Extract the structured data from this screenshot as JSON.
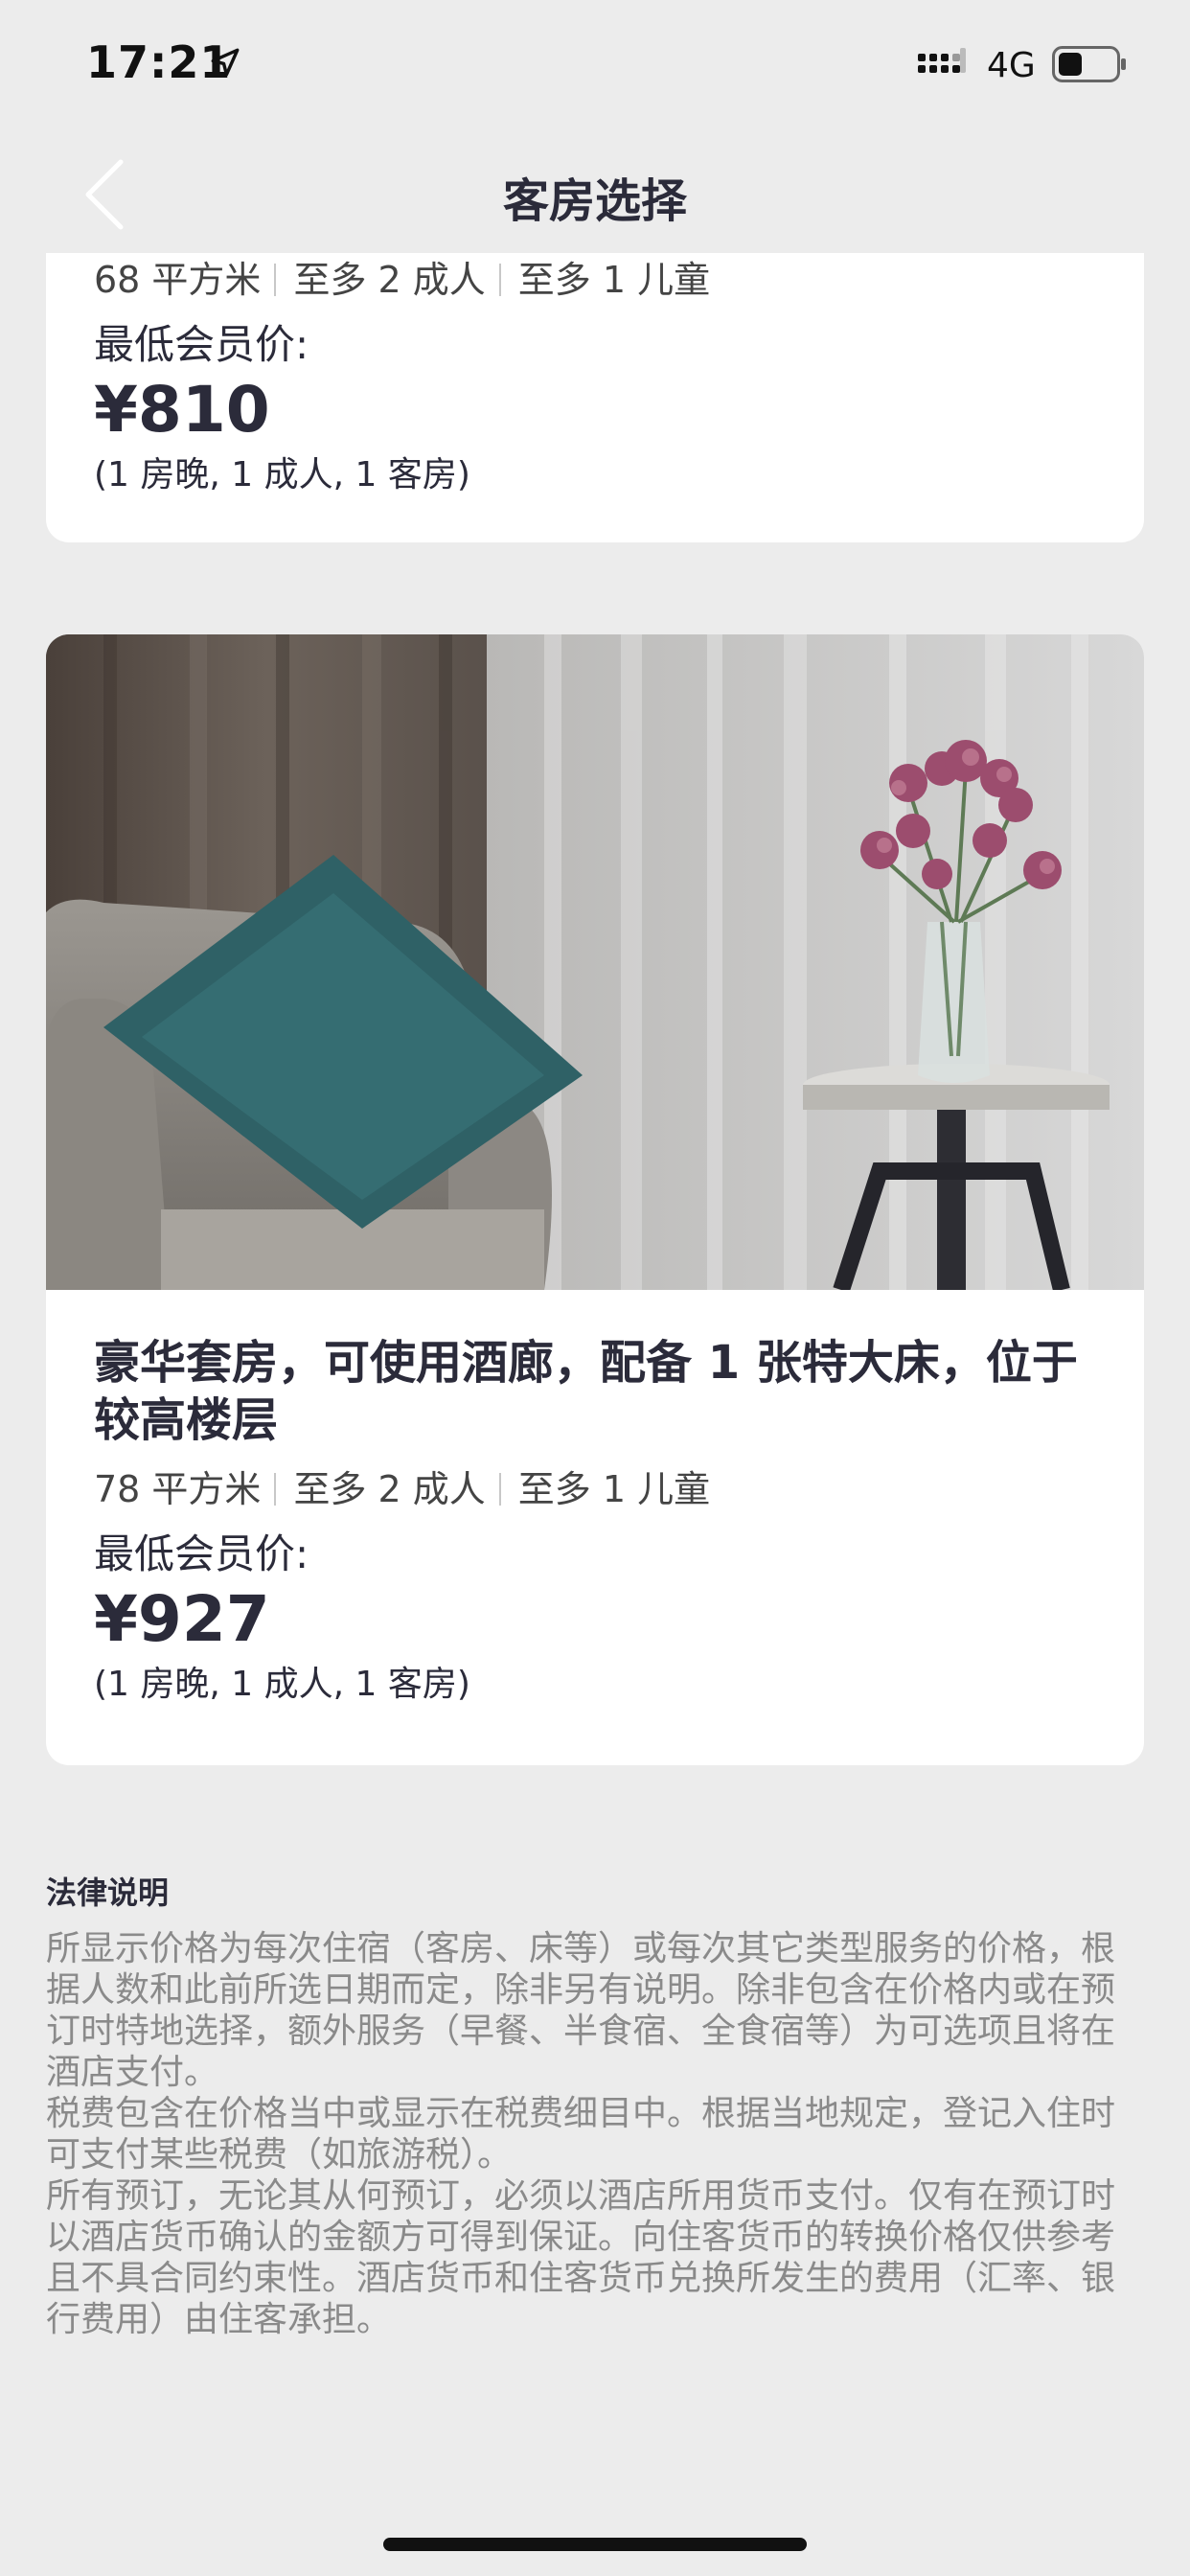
{
  "status_bar": {
    "time": "17:21",
    "network": "4G"
  },
  "nav": {
    "title": "客房选择"
  },
  "rooms": [
    {
      "name": "",
      "area": "68 平方米",
      "adults": "至多 2 成人",
      "children": "至多 1 儿童",
      "price_label": "最低会员价:",
      "price": "¥810",
      "price_note": "(1 房晚, 1 成人, 1 客房)"
    },
    {
      "name": "豪华套房，可使用酒廊，配备 1 张特大床，位于较高楼层",
      "area": "78 平方米",
      "adults": "至多 2 成人",
      "children": "至多 1 儿童",
      "price_label": "最低会员价:",
      "price": "¥927",
      "price_note": "(1 房晚, 1 成人, 1 客房)"
    }
  ],
  "legal": {
    "title": "法律说明",
    "paragraphs": [
      "所显示价格为每次住宿（客房、床等）或每次其它类型服务的价格，根据人数和此前所选日期而定，除非另有说明。除非包含在价格内或在预订时特地选择，额外服务（早餐、半食宿、全食宿等）为可选项且将在酒店支付。",
      "税费包含在价格当中或显示在税费细目中。根据当地规定，登记入住时可支付某些税费（如旅游税）。",
      "所有预订，无论其从何预订，必须以酒店所用货币支付。仅有在预订时以酒店货币确认的金额方可得到保证。向住客货币的转换价格仅供参考且不具合同约束性。酒店货币和住客货币兑换所发生的费用（汇率、银行费用）由住客承担。"
    ]
  },
  "icons": {
    "location": "location-arrow-icon",
    "signal": "cellular-signal-icon",
    "battery": "battery-icon",
    "back": "chevron-left-icon"
  },
  "colors": {
    "background": "#ececec",
    "card": "#ffffff",
    "text_primary": "#2b2b3a",
    "text_legal": "#8a8a8a"
  }
}
